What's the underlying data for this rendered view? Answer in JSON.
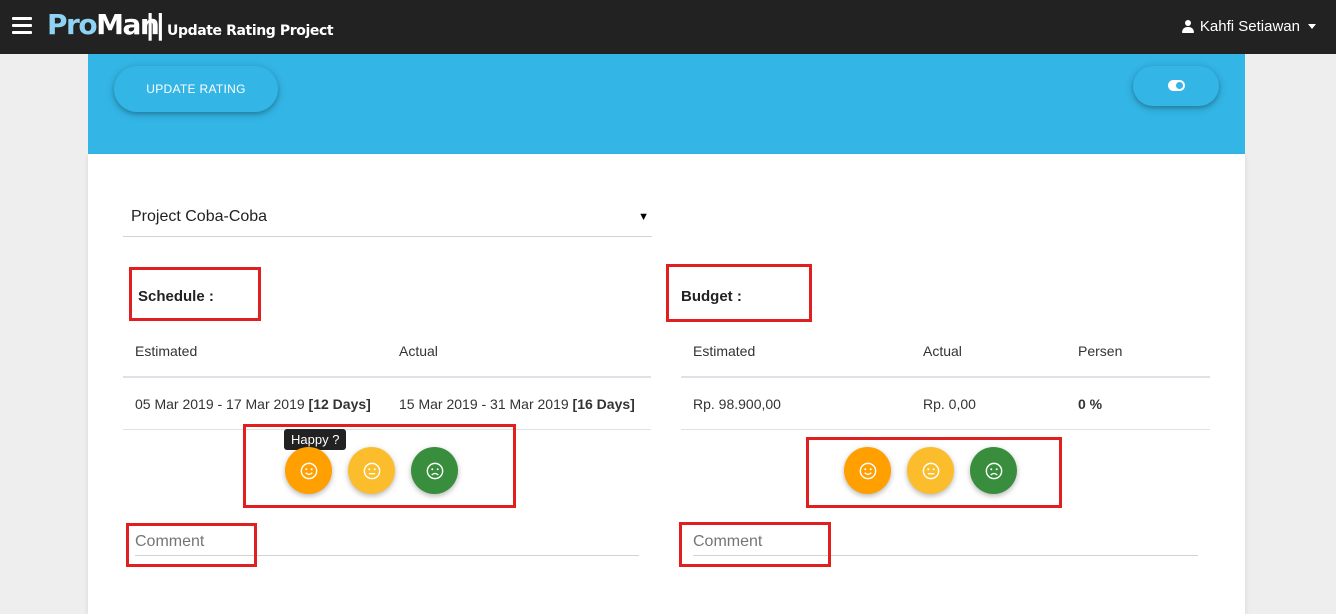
{
  "navbar": {
    "brand_pro": "Pro",
    "brand_man": "Man",
    "separator": "||",
    "page_subtitle": "Update Rating Project",
    "user_name": "Kahfi Setiawan"
  },
  "header": {
    "update_button_label": "UPDATE RATING"
  },
  "project_select": {
    "selected": "Project Coba-Coba",
    "caret": "▼"
  },
  "schedule": {
    "title": "Schedule :",
    "headers": [
      "Estimated",
      "Actual"
    ],
    "estimated": "05 Mar 2019 - 17 Mar 2019 ",
    "estimated_days": "[12 Days]",
    "actual": "15 Mar 2019 - 31 Mar 2019 ",
    "actual_days": "[16 Days]",
    "tooltip": "Happy ?",
    "comment_placeholder": "Comment"
  },
  "budget": {
    "title": "Budget :",
    "headers": [
      "Estimated",
      "Actual",
      "Persen"
    ],
    "estimated": "Rp. 98.900,00",
    "actual": "Rp. 0,00",
    "persen": "0 %",
    "comment_placeholder": "Comment"
  },
  "colors": {
    "navbar": "#222222",
    "header_blue": "#33b5e5",
    "happy": "#ff9f00",
    "neutral": "#fbbd2c",
    "sad": "#388e3c",
    "highlight_box": "#e02020"
  }
}
